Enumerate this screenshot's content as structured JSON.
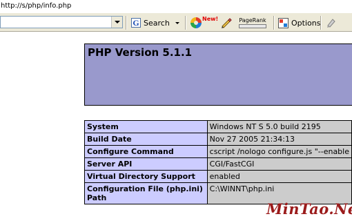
{
  "browser": {
    "address": "http://s/php/info.php"
  },
  "toolbar": {
    "search_label": "Search",
    "new_badge": "New!",
    "pagerank_label": "PageRank",
    "options_label": "Options",
    "icons": [
      "dropdown-icon",
      "google-g-icon",
      "swirl-icon",
      "pencil-icon",
      "options-icon",
      "highlighter-icon"
    ]
  },
  "page": {
    "title": "PHP Version 5.1.1",
    "rows": [
      {
        "label": "System",
        "value": "Windows NT S 5.0 build 2195"
      },
      {
        "label": "Build Date",
        "value": "Nov 27 2005 21:34:13"
      },
      {
        "label": "Configure Command",
        "value": "cscript /nologo configure.js \"--enable"
      },
      {
        "label": "Server API",
        "value": "CGI/FastCGI"
      },
      {
        "label": "Virtual Directory Support",
        "value": "enabled"
      },
      {
        "label": "Configuration File (php.ini) Path",
        "value": "C:\\WINNT\\php.ini"
      }
    ]
  },
  "watermark": "MinTao.Net",
  "colors": {
    "header_bg": "#9999cc",
    "label_bg": "#ccccff",
    "value_bg": "#cccccc",
    "toolbar_bg": "#ece9d8"
  }
}
